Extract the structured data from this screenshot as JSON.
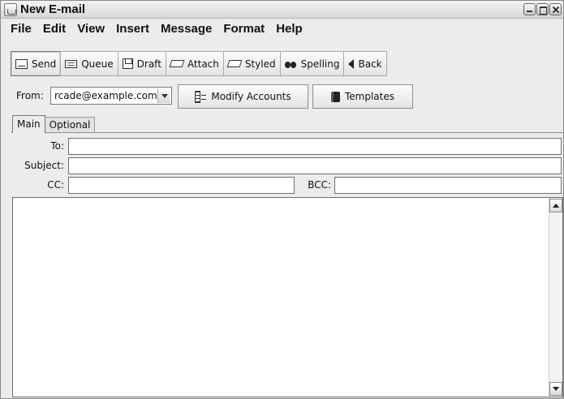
{
  "window": {
    "title": "New E-mail"
  },
  "menubar": {
    "items": [
      "File",
      "Edit",
      "View",
      "Insert",
      "Message",
      "Format",
      "Help"
    ]
  },
  "toolbar": {
    "buttons": [
      {
        "label": "Send",
        "icon": "send-icon"
      },
      {
        "label": "Queue",
        "icon": "queue-icon"
      },
      {
        "label": "Draft",
        "icon": "draft-icon"
      },
      {
        "label": "Attach",
        "icon": "attach-icon"
      },
      {
        "label": "Styled",
        "icon": "styled-icon"
      },
      {
        "label": "Spelling",
        "icon": "spelling-icon"
      },
      {
        "label": "Back",
        "icon": "back-arrow-icon"
      }
    ]
  },
  "from": {
    "label": "From:",
    "value": "rcade@example.com",
    "modify_accounts_label": "Modify Accounts",
    "templates_label": "Templates"
  },
  "tabs": {
    "main": "Main",
    "optional": "Optional"
  },
  "fields": {
    "to_label": "To:",
    "to_value": "",
    "subject_label": "Subject:",
    "subject_value": "",
    "cc_label": "CC:",
    "cc_value": "",
    "bcc_label": "BCC:",
    "bcc_value": ""
  },
  "body": {
    "text": ""
  }
}
